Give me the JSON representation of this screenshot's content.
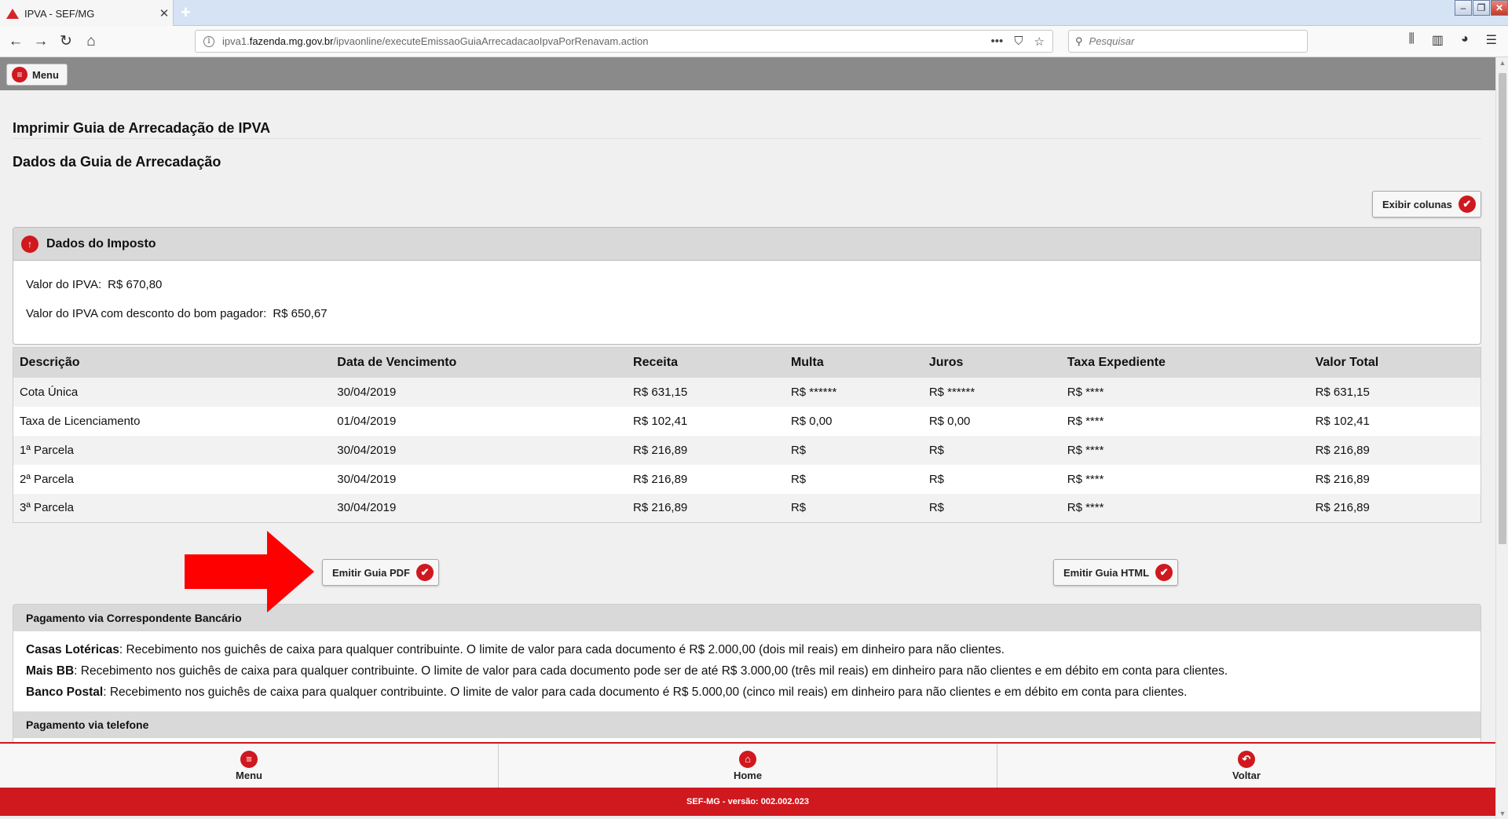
{
  "browser": {
    "tab_title": "IPVA - SEF/MG",
    "url_prefix": "ipva1.",
    "url_domain": "fazenda.mg.gov.br",
    "url_path": "/ipvaonline/executeEmissaoGuiaArrecadacaoIpvaPorRenavam.action",
    "search_placeholder": "Pesquisar"
  },
  "app": {
    "menu_label": "Menu"
  },
  "page": {
    "title": "Imprimir Guia de Arrecadação de IPVA",
    "subtitle": "Dados da Guia de Arrecadação",
    "exibir_colunas": "Exibir colunas"
  },
  "imposto": {
    "header": "Dados do Imposto",
    "valor_label": "Valor do IPVA:",
    "valor": "R$ 670,80",
    "desconto_label": "Valor do IPVA com desconto do bom pagador:",
    "desconto": "R$ 650,67"
  },
  "table": {
    "headers": [
      "Descrição",
      "Data de Vencimento",
      "Receita",
      "Multa",
      "Juros",
      "Taxa Expediente",
      "Valor Total"
    ],
    "rows": [
      [
        "Cota Única",
        "30/04/2019",
        "R$ 631,15",
        "R$ ******",
        "R$ ******",
        "R$ ****",
        "R$ 631,15"
      ],
      [
        "Taxa de Licenciamento",
        "01/04/2019",
        "R$ 102,41",
        "R$ 0,00",
        "R$ 0,00",
        "R$ ****",
        "R$ 102,41"
      ],
      [
        "1ª Parcela",
        "30/04/2019",
        "R$ 216,89",
        "R$",
        "R$",
        "R$ ****",
        "R$ 216,89"
      ],
      [
        "2ª Parcela",
        "30/04/2019",
        "R$ 216,89",
        "R$",
        "R$",
        "R$ ****",
        "R$ 216,89"
      ],
      [
        "3ª Parcela",
        "30/04/2019",
        "R$ 216,89",
        "R$",
        "R$",
        "R$ ****",
        "R$ 216,89"
      ]
    ]
  },
  "actions": {
    "pdf": "Emitir Guia PDF",
    "html": "Emitir Guia HTML"
  },
  "pagamento": {
    "header": "Pagamento via Correspondente Bancário",
    "items": [
      {
        "name": "Casas Lotéricas",
        "text": ": Recebimento nos guichês de caixa para qualquer contribuinte. O limite de valor para cada documento é R$ 2.000,00 (dois mil reais) em dinheiro para não clientes."
      },
      {
        "name": "Mais BB",
        "text": ": Recebimento nos guichês de caixa para qualquer contribuinte. O limite de valor para cada documento pode ser de até R$ 3.000,00 (três mil reais) em dinheiro para não clientes e em débito em conta para clientes."
      },
      {
        "name": "Banco Postal",
        "text": ": Recebimento nos guichês de caixa para qualquer contribuinte. O limite de valor para cada documento é R$ 5.000,00 (cinco mil reais) em dinheiro para não clientes e em débito em conta para clientes."
      }
    ],
    "telefone_header": "Pagamento via telefone"
  },
  "bottomnav": {
    "menu": "Menu",
    "home": "Home",
    "voltar": "Voltar"
  },
  "footer": "SEF-MG - versão: 002.002.023",
  "colors": {
    "brand_red": "#d0181f",
    "header_gray": "#8a8a8a"
  }
}
